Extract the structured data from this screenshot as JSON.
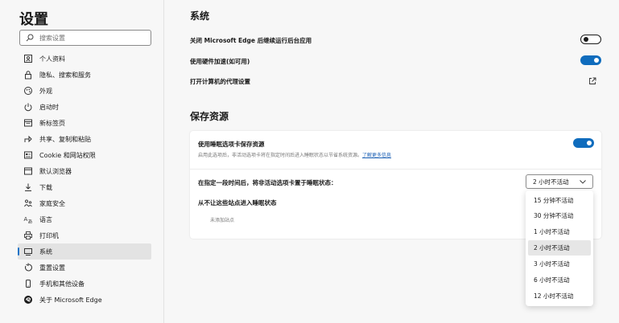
{
  "sidebar": {
    "title": "设置",
    "search_placeholder": "搜索设置",
    "items": [
      {
        "label": "个人资料",
        "icon": "profile-icon"
      },
      {
        "label": "隐私、搜索和服务",
        "icon": "lock-icon"
      },
      {
        "label": "外观",
        "icon": "appearance-icon"
      },
      {
        "label": "启动时",
        "icon": "power-icon"
      },
      {
        "label": "新标签页",
        "icon": "new-tab-icon"
      },
      {
        "label": "共享、复制和粘贴",
        "icon": "share-icon"
      },
      {
        "label": "Cookie 和网站权限",
        "icon": "site-permissions-icon"
      },
      {
        "label": "默认浏览器",
        "icon": "browser-icon"
      },
      {
        "label": "下载",
        "icon": "download-icon"
      },
      {
        "label": "家庭安全",
        "icon": "family-icon"
      },
      {
        "label": "语言",
        "icon": "language-icon"
      },
      {
        "label": "打印机",
        "icon": "printer-icon"
      },
      {
        "label": "系统",
        "icon": "system-icon",
        "active": true
      },
      {
        "label": "重置设置",
        "icon": "reset-icon"
      },
      {
        "label": "手机和其他设备",
        "icon": "phone-icon"
      },
      {
        "label": "关于 Microsoft Edge",
        "icon": "edge-logo-icon"
      }
    ]
  },
  "system": {
    "title": "系统",
    "background_apps_label": "关闭 Microsoft Edge 后继续运行后台应用",
    "background_apps_on": false,
    "hardware_accel_label": "使用硬件加速(如可用)",
    "hardware_accel_on": true,
    "proxy_label": "打开计算机的代理设置"
  },
  "resources": {
    "title": "保存资源",
    "sleeping_tabs_label": "使用睡眠选项卡保存资源",
    "sleeping_tabs_on": true,
    "sleeping_tabs_desc": "启用此选项后，非活动选项卡将在指定时间后进入睡眠状态以节省系统资源。",
    "learn_more": "了解更多信息",
    "sleep_after_label": "在指定一段时间后，将非活动选项卡置于睡眠状态：",
    "sleep_after_value": "2 小时不活动",
    "never_sleep_label": "从不让这些站点进入睡眠状态",
    "no_sites": "未添加站点"
  },
  "dropdown": {
    "options": [
      "15 分钟不活动",
      "30 分钟不活动",
      "1 小时不活动",
      "2 小时不活动",
      "3 小时不活动",
      "6 小时不活动",
      "12 小时不活动"
    ],
    "selected_index": 3
  },
  "colors": {
    "accent": "#0f6cbd",
    "link": "#1a5fb4"
  }
}
